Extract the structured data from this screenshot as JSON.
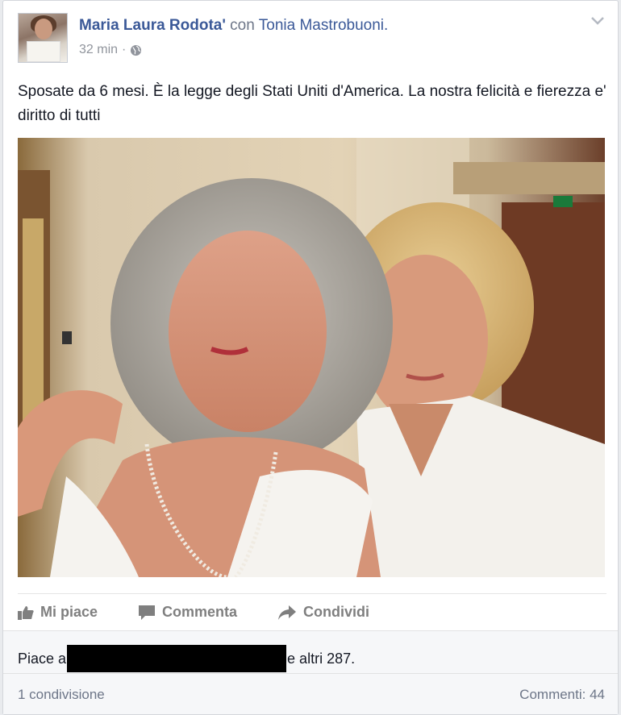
{
  "post": {
    "author": "Maria Laura Rodota'",
    "with_text": "con",
    "tagged_user": "Tonia Mastrobuoni.",
    "time": "32 min",
    "separator": "·",
    "audience_icon": "globe-icon",
    "text": "Sposate da 6 mesi. È la legge degli Stati Uniti d'America. La nostra felicità e fierezza e' diritto di tutti"
  },
  "actions": {
    "like": "Mi piace",
    "comment": "Commenta",
    "share": "Condividi"
  },
  "likes": {
    "prefix": "Piace a",
    "suffix": "e altri 287."
  },
  "footer": {
    "shares": "1 condivisione",
    "comments": "Commenti: 44"
  },
  "colors": {
    "link": "#3b5998",
    "muted": "#90949c",
    "action": "#7f7f7f",
    "footer_bg": "#f6f7f9"
  }
}
